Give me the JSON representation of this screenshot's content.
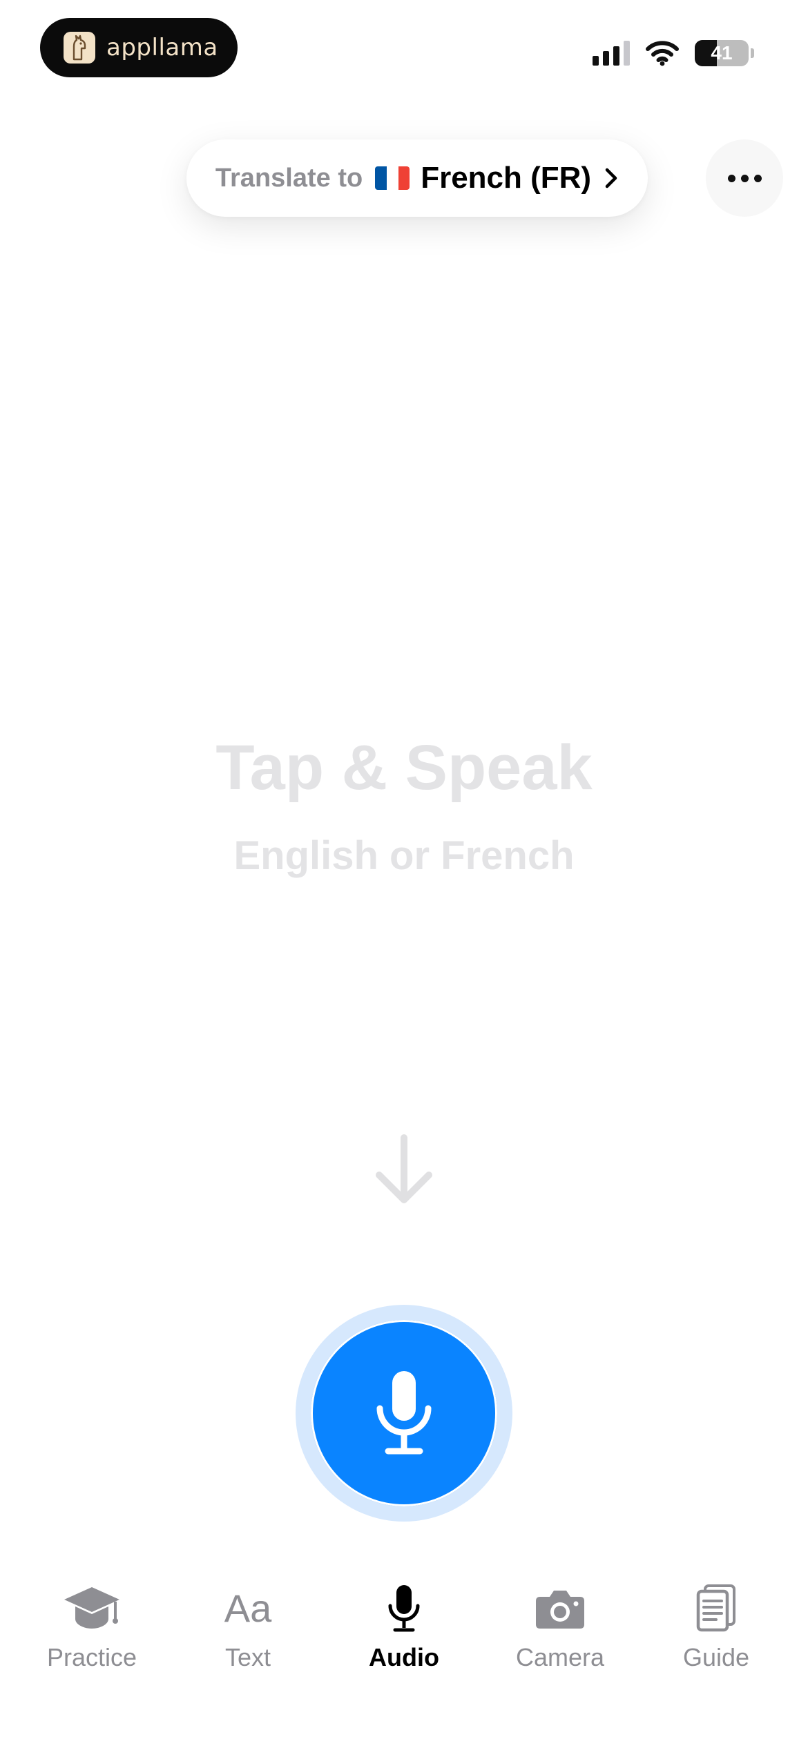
{
  "status_bar": {
    "brand_name": "appllama",
    "battery_level": "41",
    "battery_percent": 41,
    "signal_bars_filled": 3,
    "signal_bars_total": 4
  },
  "translate": {
    "label": "Translate to",
    "language": "French (FR)",
    "flag_colors": [
      "#0055a4",
      "#ffffff",
      "#ef4135"
    ]
  },
  "prompt": {
    "title": "Tap & Speak",
    "subtitle": "English or French"
  },
  "colors": {
    "accent": "#0a84ff",
    "inactive": "#8e8e93"
  },
  "tabs": [
    {
      "label": "Practice",
      "icon": "graduation-cap-icon",
      "active": false
    },
    {
      "label": "Text",
      "icon": "text-aa-icon",
      "active": false
    },
    {
      "label": "Audio",
      "icon": "microphone-icon",
      "active": true
    },
    {
      "label": "Camera",
      "icon": "camera-icon",
      "active": false
    },
    {
      "label": "Guide",
      "icon": "document-guide-icon",
      "active": false
    }
  ]
}
